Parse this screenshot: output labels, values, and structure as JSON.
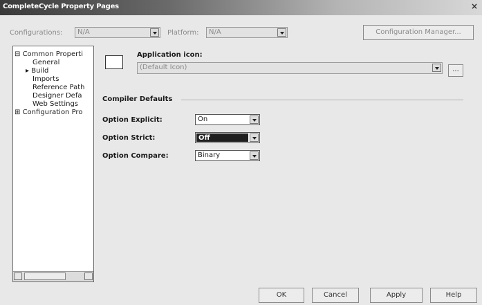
{
  "window": {
    "title": "CompleteCycle Property Pages",
    "close_glyph": "×"
  },
  "top_bar": {
    "configurations_label": "Configurations:",
    "configurations_value": "N/A",
    "platform_label": "Platform:",
    "platform_value": "N/A",
    "config_manager_label": "Configuration Manager..."
  },
  "tree": {
    "items": [
      {
        "label": "Common Properti",
        "glyph": "⊟"
      },
      {
        "label": "General"
      },
      {
        "label": "Build",
        "glyph": "▸"
      },
      {
        "label": "Imports"
      },
      {
        "label": "Reference Path"
      },
      {
        "label": "Designer Defa"
      },
      {
        "label": "Web Settings"
      },
      {
        "label": "Configuration Pro",
        "glyph": "⊞"
      }
    ]
  },
  "app_icon": {
    "label": "Application icon:",
    "value": "(Default Icon)",
    "browse_label": "..."
  },
  "compiler": {
    "section_title": "Compiler Defaults",
    "option_explicit_label": "Option Explicit:",
    "option_explicit_value": "On",
    "option_strict_label": "Option Strict:",
    "option_strict_value": "Off",
    "option_compare_label": "Option Compare:",
    "option_compare_value": "Binary"
  },
  "buttons": {
    "ok": "OK",
    "cancel": "Cancel",
    "apply": "Apply",
    "help": "Help"
  }
}
